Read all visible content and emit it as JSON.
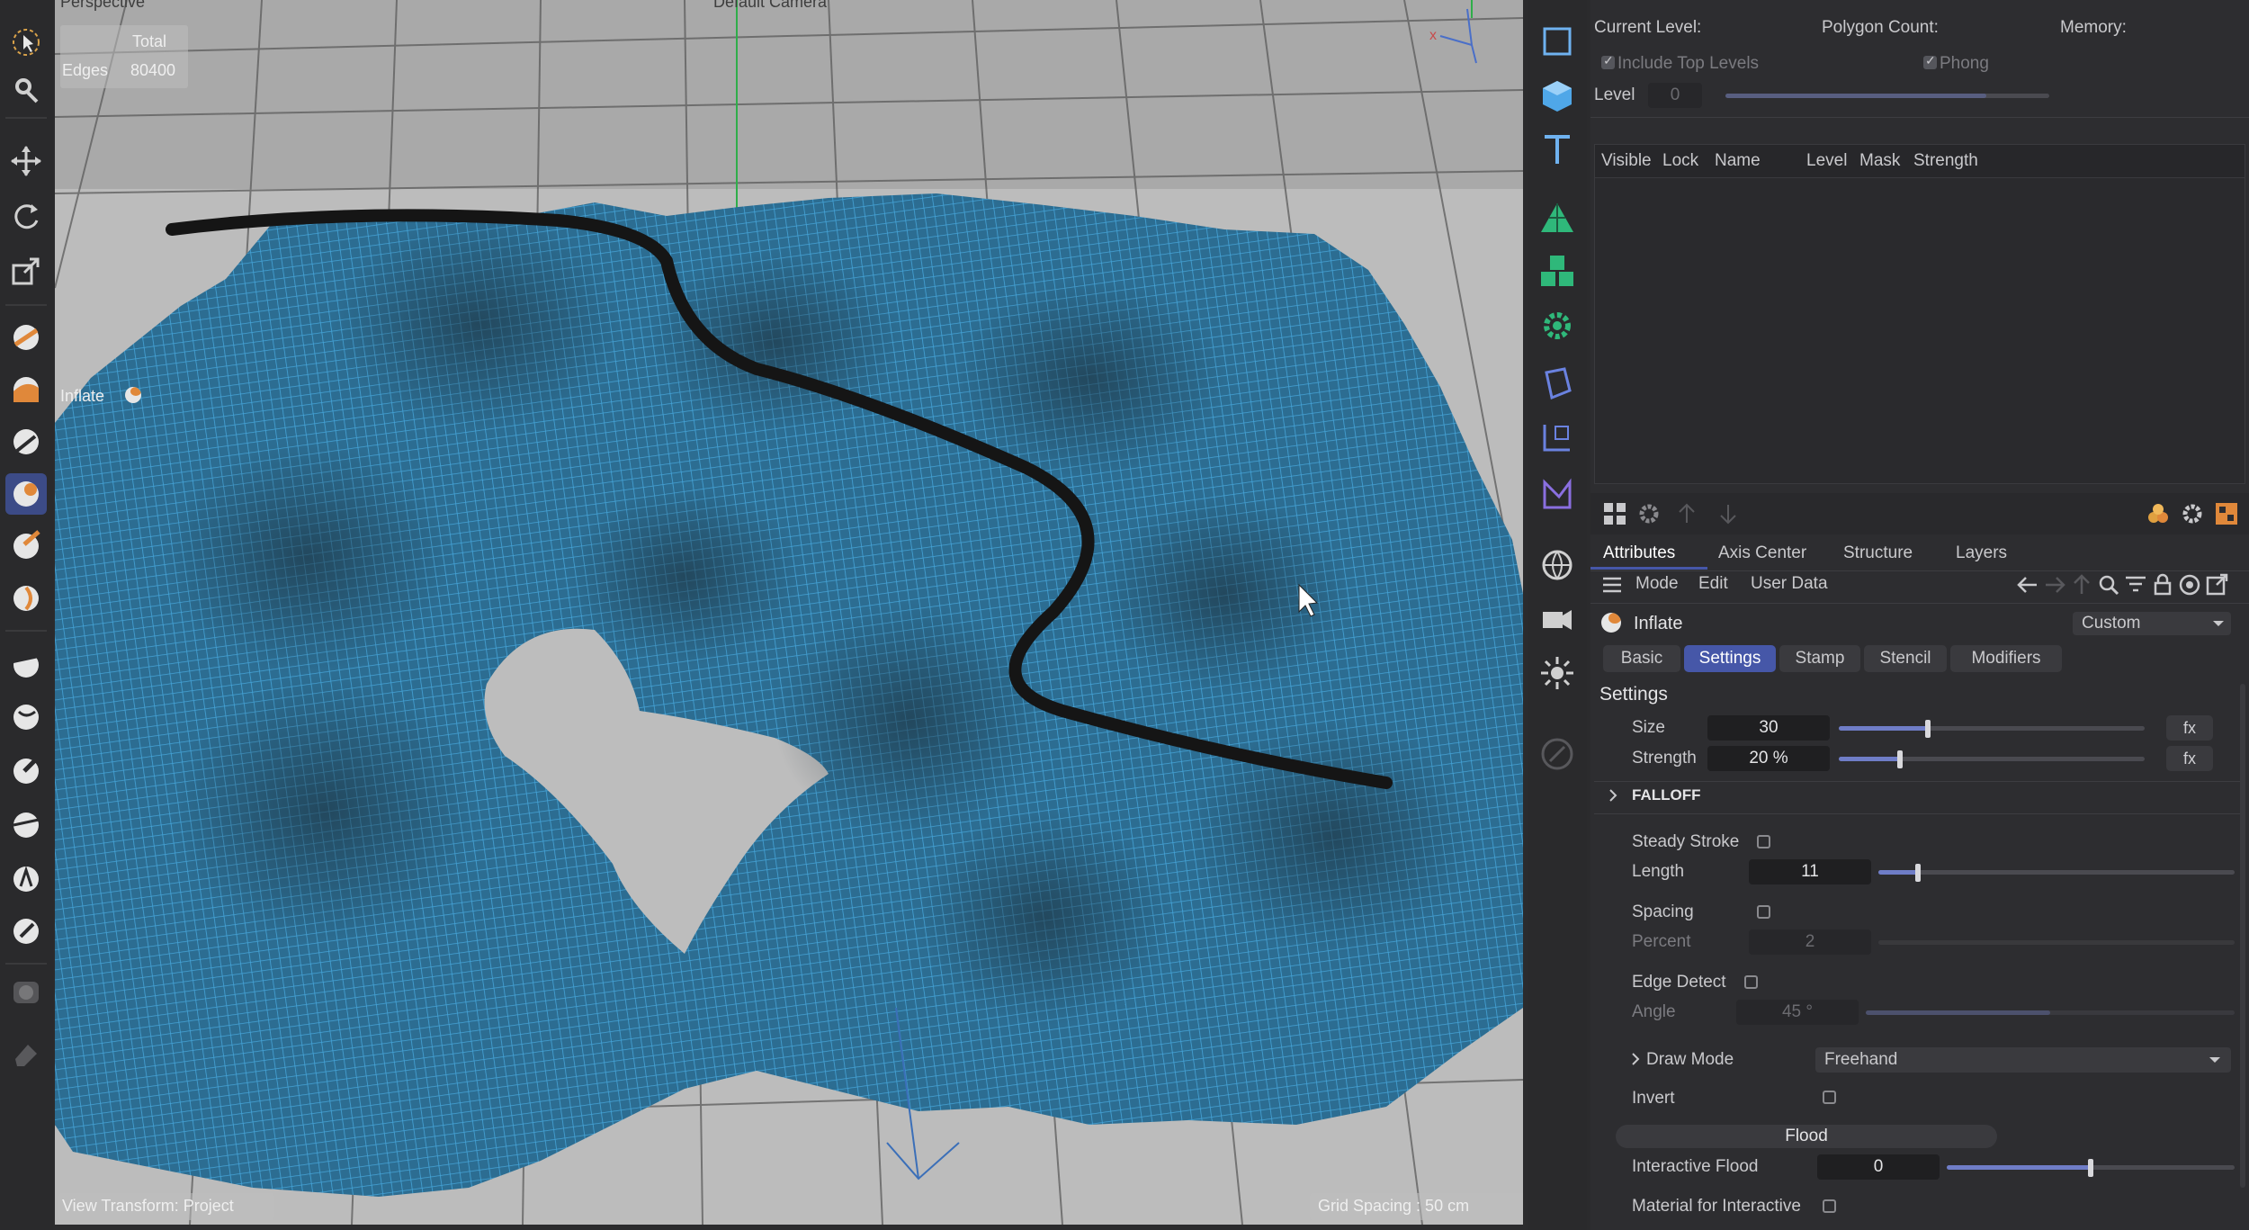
{
  "viewport": {
    "title_left": "Perspective",
    "title_center": "Default Camera",
    "hud": {
      "total_label": "Total",
      "edges_label": "Edges",
      "edges_value": "80400"
    },
    "brush_label": "Inflate",
    "view_transform": "View Transform: Project",
    "grid_spacing": "Grid Spacing : 50 cm"
  },
  "left_tools": [
    {
      "name": "select-icon"
    },
    {
      "name": "settings-tool-icon"
    },
    {
      "name": "move-icon"
    },
    {
      "name": "rotate-icon"
    },
    {
      "name": "scale-icon"
    },
    {
      "name": "sculpt-pull-icon"
    },
    {
      "name": "sculpt-grab-icon"
    },
    {
      "name": "sculpt-smooth-icon"
    },
    {
      "name": "sculpt-inflate-icon"
    },
    {
      "name": "sculpt-pinch-icon"
    },
    {
      "name": "sculpt-twist-icon"
    },
    {
      "name": "sculpt-flatten-icon"
    },
    {
      "name": "sculpt-fill-icon"
    },
    {
      "name": "sculpt-scrape-icon"
    },
    {
      "name": "sculpt-knife-icon"
    },
    {
      "name": "sculpt-amplify-icon"
    },
    {
      "name": "sculpt-erase-icon"
    },
    {
      "name": "camera-brush-icon"
    },
    {
      "name": "eraser-icon"
    }
  ],
  "mid_tools": [
    {
      "name": "cube-outline-icon"
    },
    {
      "name": "cube-icon"
    },
    {
      "name": "text-icon"
    },
    {
      "name": "mesh-triangle-icon"
    },
    {
      "name": "cloner-icon"
    },
    {
      "name": "gear-generator-icon"
    },
    {
      "name": "deformer-icon"
    },
    {
      "name": "spline-icon"
    },
    {
      "name": "bend-icon"
    },
    {
      "name": "globe-st-icon"
    },
    {
      "name": "camera-st-icon"
    },
    {
      "name": "light-st-icon"
    },
    {
      "name": "brush-disabled-icon"
    }
  ],
  "layers_panel": {
    "current_level_label": "Current Level:",
    "polygon_count_label": "Polygon Count:",
    "memory_label": "Memory:",
    "include_top_levels": "Include Top Levels",
    "phong": "Phong",
    "level_label": "Level",
    "level_value": "0",
    "columns": [
      "Visible",
      "Lock",
      "Name",
      "Level",
      "Mask",
      "Strength"
    ]
  },
  "attributes": {
    "tabs": [
      "Attributes",
      "Axis Center",
      "Structure",
      "Layers"
    ],
    "menu": [
      "Mode",
      "Edit",
      "User Data"
    ],
    "object_name": "Inflate",
    "preset": "Custom",
    "sub_tabs": [
      "Basic",
      "Settings",
      "Stamp",
      "Stencil",
      "Modifiers"
    ],
    "active_sub_tab": "Settings",
    "section": "Settings",
    "size_label": "Size",
    "size_value": "30",
    "size_fraction": 0.29,
    "strength_label": "Strength",
    "strength_value": "20 %",
    "strength_fraction": 0.2,
    "fx": "fx",
    "falloff_label": "FALLOFF",
    "steady_stroke_label": "Steady Stroke",
    "length_label": "Length",
    "length_value": "11",
    "length_fraction": 0.11,
    "spacing_label": "Spacing",
    "percent_label": "Percent",
    "percent_value": "2",
    "edge_detect_label": "Edge Detect",
    "angle_label": "Angle",
    "angle_value": "45 °",
    "angle_fraction": 0.5,
    "draw_mode_label": "Draw Mode",
    "draw_mode_value": "Freehand",
    "invert_label": "Invert",
    "flood_label": "Flood",
    "interactive_flood_label": "Interactive Flood",
    "interactive_flood_value": "0",
    "interactive_flood_fraction": 0.5,
    "material_label": "Material for Interactive"
  },
  "colors": {
    "accent": "#4657a8",
    "mesh": "#2f86b8",
    "background": "#2d2d30"
  }
}
